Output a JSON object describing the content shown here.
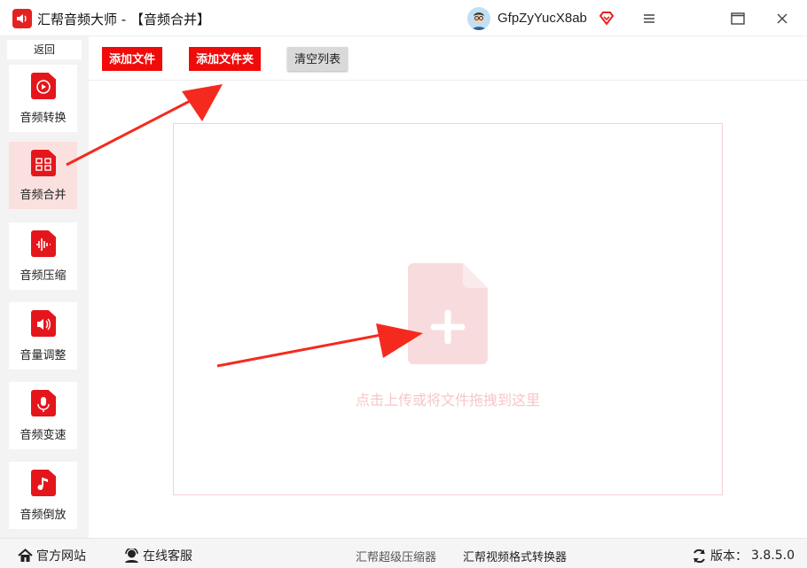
{
  "window": {
    "app_name": "汇帮音频大师",
    "separator": " - ",
    "page_title": "【音频合并】",
    "user_name": "GfpZyYucX8ab"
  },
  "sidebar": {
    "back_label": "返回",
    "items": [
      {
        "label": "音频转换",
        "icon": "audio-convert-icon"
      },
      {
        "label": "音频合并",
        "icon": "audio-merge-icon",
        "active": true
      },
      {
        "label": "音频压缩",
        "icon": "audio-compress-icon"
      },
      {
        "label": "音量调整",
        "icon": "volume-adjust-icon"
      },
      {
        "label": "音频变速",
        "icon": "audio-speed-icon"
      },
      {
        "label": "音频倒放",
        "icon": "audio-reverse-icon"
      }
    ]
  },
  "toolbar": {
    "add_file_label": "添加文件",
    "add_folder_label": "添加文件夹",
    "clear_list_label": "清空列表"
  },
  "dropzone": {
    "hint": "点击上传或将文件拖拽到这里"
  },
  "footer": {
    "website_label": "官方网站",
    "support_label": "在线客服",
    "promo_compressor": "汇帮超级压缩器",
    "promo_video": "汇帮视频格式转换器",
    "version_label": "版本：",
    "version_value": "3.8.5.0"
  },
  "colors": {
    "brand_red": "#f00a0a",
    "active_bg": "#fbe0e0",
    "hint_pink": "#f7c6c8"
  }
}
